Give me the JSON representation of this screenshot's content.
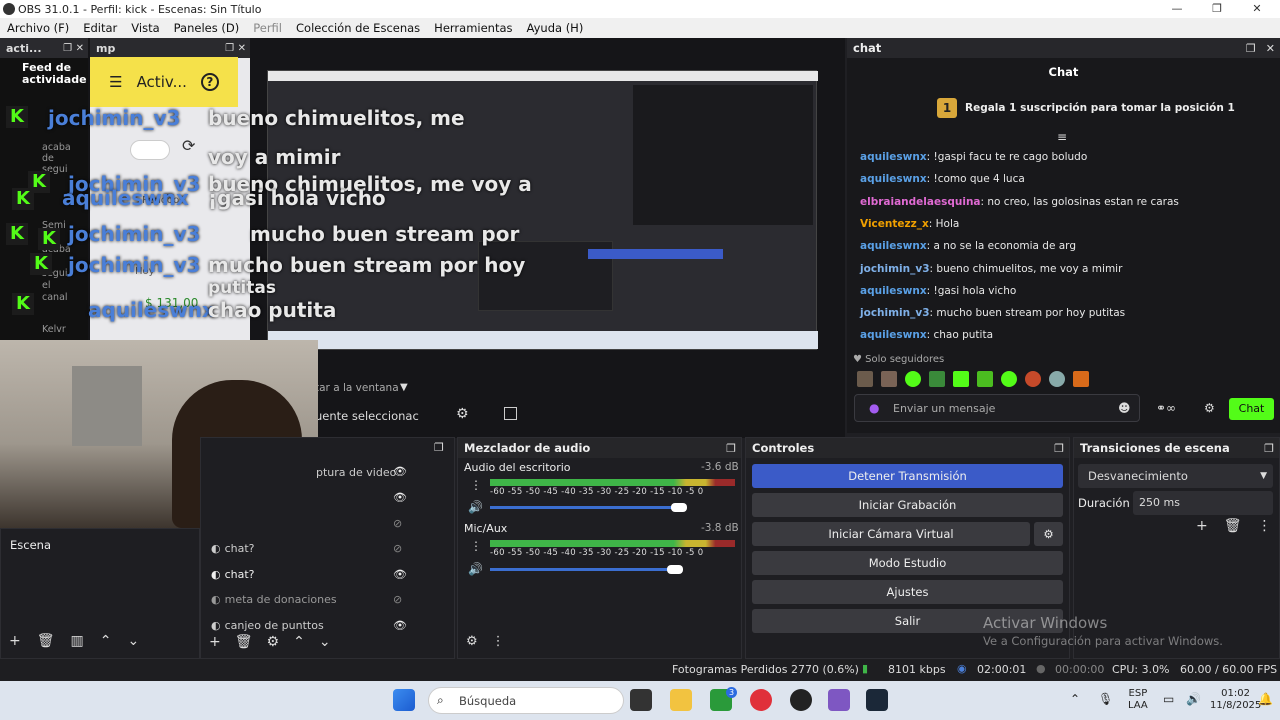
{
  "window": {
    "title": "OBS 31.0.1 - Perfil: kick - Escenas: Sin Título",
    "minimize": "—",
    "maximize": "❐",
    "close": "✕"
  },
  "menu": [
    "Archivo (F)",
    "Editar",
    "Vista",
    "Paneles (D)",
    "Perfil",
    "Colección de Escenas",
    "Herramientas",
    "Ayuda (H)"
  ],
  "docks_top": {
    "activity_tab": "acti...",
    "mp_tab": "mp",
    "chat_tab": "chat"
  },
  "preview": {
    "feed_label": "Feed de actividade",
    "mp_button": "Activ...",
    "overlay_users": [
      "jochimin_v3",
      "jochimin_v3",
      "aquileswnx",
      "jochimin_v3",
      "jochimin_v3",
      "aquileswnx"
    ],
    "overlay_msgs": [
      "bueno chimuelitos, me",
      "voy a mimir",
      "bueno chimuelitos, me voy a",
      "¡gasi hola vicho",
      "¡gasi hola vicho",
      "mucho buen stream por",
      "mucho buen stream por hoy",
      "hoy putitas",
      "putitas",
      "chao putita",
      "chao putita"
    ],
    "side_texts": [
      "acaba de segui",
      "Hoy",
      "$ 131,00",
      "Periodo",
      "Semi",
      "acaba",
      "segui",
      "el",
      "canal",
      "Kelvr"
    ],
    "source_hint": "tar a la ventana",
    "source_selected": "uente seleccionac",
    "activate_win": "Activar Windows",
    "activate_win_sub": "Ve a Configuración para activar Windows."
  },
  "chat": {
    "header": "Chat",
    "gift_banner": "Regala 1 suscripción para tomar la posición 1",
    "gift_rank": "1",
    "messages": [
      {
        "user": "aquileswnx",
        "text": ": !gaspi facu te re cago boludo",
        "cls": "u"
      },
      {
        "user": "aquileswnx",
        "text": ": !como que 4 luca",
        "cls": "u"
      },
      {
        "user": "elbraiandelaesquina",
        "text": ": no creo, las golosinas estan re caras",
        "cls": "m"
      },
      {
        "user": "Vicentezz_x",
        "text": ": Hola",
        "cls": "v"
      },
      {
        "user": "aquileswnx",
        "text": ": a no se la economia de arg",
        "cls": "u"
      },
      {
        "user": "jochimin_v3",
        "text": ": bueno chimuelitos, me voy a mimir",
        "cls": "g"
      },
      {
        "user": "aquileswnx",
        "text": ": !gasi hola vicho",
        "cls": "u"
      },
      {
        "user": "jochimin_v3",
        "text": ": mucho buen stream por hoy putitas",
        "cls": "g"
      },
      {
        "user": "aquileswnx",
        "text": ": chao putita",
        "cls": "u"
      }
    ],
    "followers_only": "Solo seguidores",
    "input_placeholder": "Enviar un mensaje",
    "send_button": "Chat"
  },
  "scenes": {
    "item": "Escena"
  },
  "sources": {
    "items": [
      "ptura de video",
      "",
      "",
      "chat?",
      "chat?",
      "meta de donaciones",
      "canjeo de punttos"
    ]
  },
  "audio": {
    "title": "Mezclador de audio",
    "channels": [
      {
        "name": "Audio del escritorio",
        "db": "-3.6 dB",
        "level": 0.88
      },
      {
        "name": "Mic/Aux",
        "db": "-3.8 dB",
        "level": 0.86
      }
    ],
    "scale": "-60 -55 -50 -45 -40 -35 -30 -25 -20 -15 -10 -5 0"
  },
  "controls": {
    "title": "Controles",
    "buttons": [
      "Detener Transmisión",
      "Iniciar Grabación",
      "Iniciar Cámara Virtual",
      "Modo Estudio",
      "Ajustes",
      "Salir"
    ]
  },
  "transitions": {
    "title": "Transiciones de escena",
    "selected": "Desvanecimiento",
    "duration_label": "Duración",
    "duration_value": "250 ms"
  },
  "status": {
    "frames": "Fotogramas Perdidos 2770 (0.6%)",
    "kbps": "8101 kbps",
    "live_time": "02:00:01",
    "rec_time": "00:00:00",
    "cpu": "CPU: 3.0%",
    "fps": "60.00 / 60.00 FPS"
  },
  "taskbar": {
    "search": "Búsqueda",
    "lang1": "ESP",
    "lang2": "LAA",
    "time": "01:02",
    "date": "11/8/2025",
    "badge": "3"
  },
  "colors": {
    "accent": "#3b5bc8",
    "kick_green": "#53fc18",
    "obs_bg": "#1f1f23"
  }
}
